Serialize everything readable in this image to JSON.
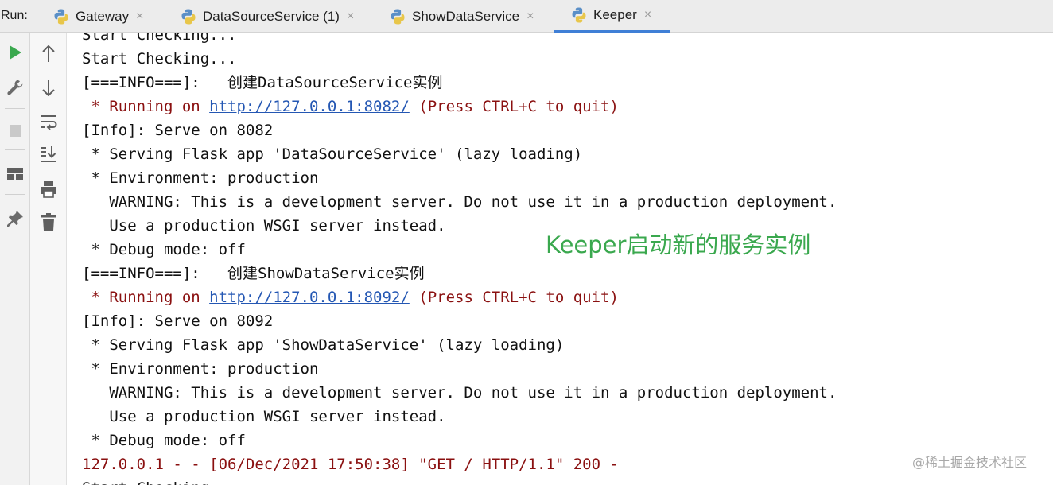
{
  "run_label": "Run:",
  "tabs": [
    {
      "label": "Gateway",
      "icon": "python-icon",
      "active": false
    },
    {
      "label": "DataSourceService (1)",
      "icon": "python-icon",
      "active": false
    },
    {
      "label": "ShowDataService",
      "icon": "python-icon",
      "active": false
    },
    {
      "label": "Keeper",
      "icon": "python-icon",
      "active": true
    }
  ],
  "close_glyph": "×",
  "toolbar_left": [
    "rerun-icon",
    "settings-wrench-icon",
    "stop-icon",
    "layout-icon",
    "pin-icon"
  ],
  "toolbar_right": [
    "scroll-up-icon",
    "scroll-down-icon",
    "soft-wrap-icon",
    "scroll-to-end-icon",
    "print-icon",
    "clear-all-icon"
  ],
  "console_lines": [
    {
      "text": "Start Checking...",
      "style": "default"
    },
    {
      "text": "Start Checking...",
      "style": "default"
    },
    {
      "text": "[===INFO===]:   创建DataSourceService实例",
      "style": "default"
    },
    {
      "prefix": " * Running on ",
      "link": "http://127.0.0.1:8082/",
      "suffix": " (Press CTRL+C to quit)",
      "style": "red"
    },
    {
      "text": "[Info]: Serve on 8082",
      "style": "default"
    },
    {
      "text": " * Serving Flask app 'DataSourceService' (lazy loading)",
      "style": "default"
    },
    {
      "text": " * Environment: production",
      "style": "default"
    },
    {
      "text": "   WARNING: This is a development server. Do not use it in a production deployment.",
      "style": "default"
    },
    {
      "text": "   Use a production WSGI server instead.",
      "style": "default"
    },
    {
      "text": " * Debug mode: off",
      "style": "default"
    },
    {
      "text": "[===INFO===]:   创建ShowDataService实例",
      "style": "default"
    },
    {
      "prefix": " * Running on ",
      "link": "http://127.0.0.1:8092/",
      "suffix": " (Press CTRL+C to quit)",
      "style": "red"
    },
    {
      "text": "[Info]: Serve on 8092",
      "style": "default"
    },
    {
      "text": " * Serving Flask app 'ShowDataService' (lazy loading)",
      "style": "default"
    },
    {
      "text": " * Environment: production",
      "style": "default"
    },
    {
      "text": "   WARNING: This is a development server. Do not use it in a production deployment.",
      "style": "default"
    },
    {
      "text": "   Use a production WSGI server instead.",
      "style": "default"
    },
    {
      "text": " * Debug mode: off",
      "style": "default"
    },
    {
      "text": "127.0.0.1 - - [06/Dec/2021 17:50:38] \"GET / HTTP/1.1\" 200 -",
      "style": "red"
    },
    {
      "text": "Start Checking...",
      "style": "default"
    }
  ],
  "annotation": "Keeper启动新的服务实例",
  "watermark": "@稀土掘金技术社区",
  "colors": {
    "accent": "#3f7fd6",
    "error_red": "#8a1010",
    "link_blue": "#2457b3",
    "annotation_green": "#3aa84e",
    "run_green": "#3aa84e"
  }
}
